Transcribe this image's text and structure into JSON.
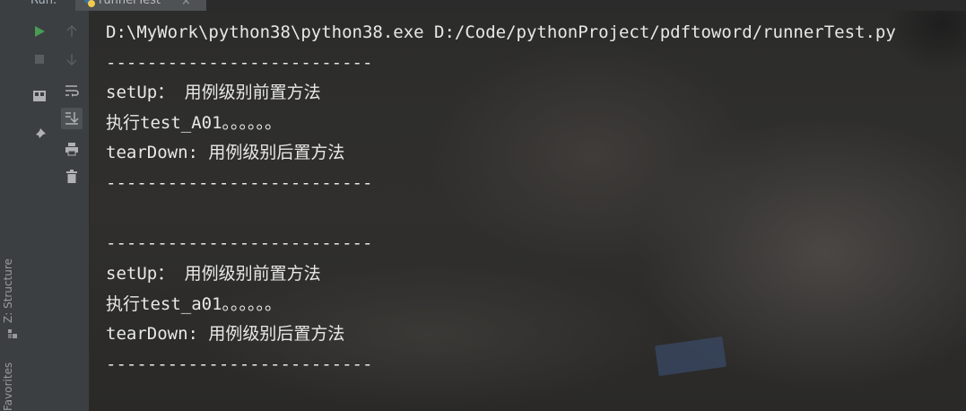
{
  "header": {
    "run_label": "Run:",
    "tab_title": "runnerTest",
    "close_glyph": "×"
  },
  "side_tabs": {
    "structure": "Z: Structure",
    "favorites": "Favorites"
  },
  "toolbar": {
    "icons": [
      "run-icon",
      "stop-icon",
      "scroll-up-icon",
      "scroll-down-icon",
      "layout-icon",
      "soft-wrap-icon",
      "pin-icon",
      "scroll-to-end-icon",
      "print-icon",
      "trash-icon"
    ],
    "colors": {
      "run": "#499c54",
      "icon": "#afb1b3",
      "disabled": "#5a5d5f"
    }
  },
  "console": {
    "lines": [
      "D:\\MyWork\\python38\\python38.exe D:/Code/pythonProject/pdftoword/runnerTest.py",
      "--------------------------",
      "setUp： 用例级别前置方法",
      "执行test_A01。。。。。。",
      "tearDown: 用例级别后置方法",
      "--------------------------",
      "",
      "--------------------------",
      "setUp： 用例级别前置方法",
      "执行test_a01。。。。。。",
      "tearDown: 用例级别后置方法",
      "--------------------------"
    ]
  }
}
